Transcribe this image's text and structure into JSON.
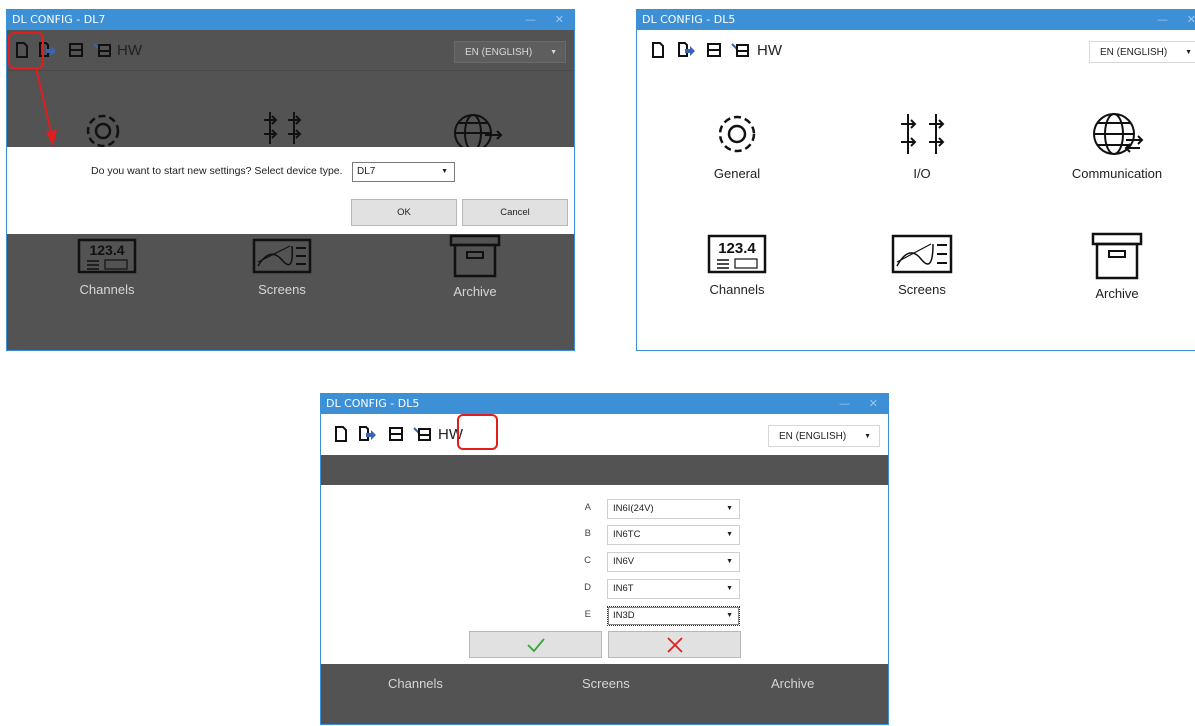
{
  "window1": {
    "title": "DL CONFIG - DL7",
    "controls": {
      "minimize": "—",
      "close": "✕"
    },
    "toolbar": {
      "hw_label": "HW",
      "language": "EN (ENGLISH)"
    },
    "tiles": [
      "Channels",
      "Screens",
      "Archive"
    ],
    "tile_icons": [
      "gear-icon",
      "io-icon",
      "globe-icon",
      "channels-icon",
      "screens-icon",
      "archive-icon"
    ],
    "dialog": {
      "question": "Do you want to start new settings? Select device type.",
      "device_type": "DL7",
      "ok_label": "OK",
      "cancel_label": "Cancel"
    }
  },
  "window2": {
    "title": "DL CONFIG - DL5",
    "controls": {
      "minimize": "—",
      "close": "✕"
    },
    "toolbar": {
      "hw_label": "HW",
      "language": "EN (ENGLISH)"
    },
    "tiles": [
      "General",
      "I/O",
      "Communication",
      "Channels",
      "Screens",
      "Archive"
    ],
    "tile_icons": [
      "gear-icon",
      "io-icon",
      "globe-icon",
      "channels-icon",
      "screens-icon",
      "archive-icon"
    ],
    "channels_icon_text": "123.4"
  },
  "window3": {
    "title": "DL CONFIG - DL5",
    "controls": {
      "minimize": "—",
      "close": "✕"
    },
    "toolbar": {
      "hw_label": "HW",
      "language": "EN (ENGLISH)"
    },
    "hw_slots": [
      {
        "letter": "A",
        "module": "IN6I(24V)"
      },
      {
        "letter": "B",
        "module": "IN6TC"
      },
      {
        "letter": "C",
        "module": "IN6V"
      },
      {
        "letter": "D",
        "module": "IN6T"
      },
      {
        "letter": "E",
        "module": "IN3D"
      }
    ],
    "confirm_icon": "checkmark-icon",
    "cancel_icon": "x-icon",
    "bottom_tiles": [
      "Channels",
      "Screens",
      "Archive"
    ]
  },
  "colors": {
    "titlebar": "#3d8fd6",
    "dim_overlay": "#535353",
    "highlight": "#e01e1e",
    "confirm_green": "#3aa53a",
    "cancel_red": "#e02020",
    "open_icon_blue": "#3a62b8"
  }
}
